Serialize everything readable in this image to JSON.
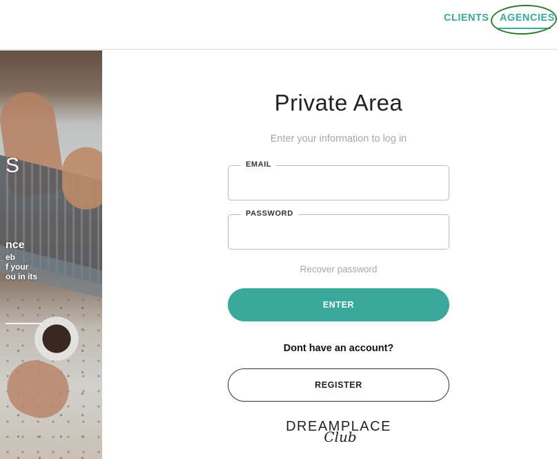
{
  "nav": {
    "clients": "CLIENTS",
    "agencies": "AGENCIES",
    "accent_color": "#3aa99c"
  },
  "panel": {
    "letter": "S",
    "line1": "nce",
    "line2": "eb",
    "line3": "f your",
    "line4": "ou in its"
  },
  "login": {
    "title": "Private Area",
    "subtitle": "Enter your information to log in",
    "email_label": "EMAIL",
    "email_value": "",
    "password_label": "PASSWORD",
    "password_value": "",
    "recover": "Recover password",
    "enter_label": "ENTER",
    "no_account": "Dont have an account?",
    "register_label": "REGISTER"
  },
  "brand": {
    "name": "DREAMPLACE",
    "script": "Club"
  },
  "annotation": {
    "color": "#2d7a2a"
  }
}
